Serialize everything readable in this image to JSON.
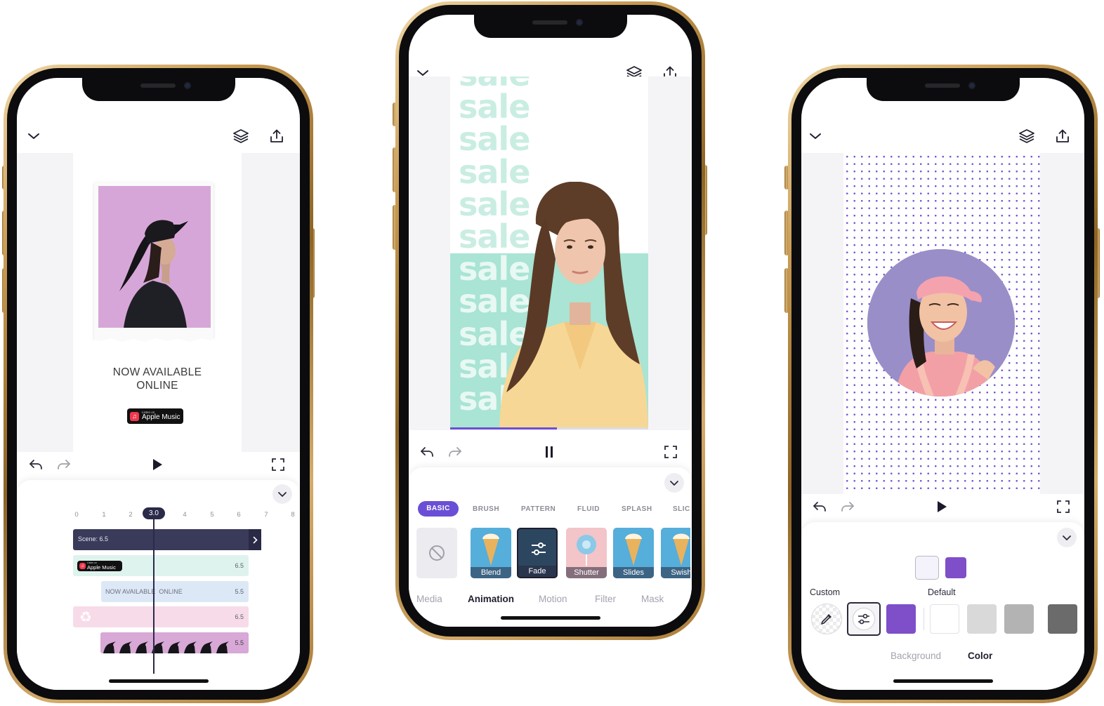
{
  "icons": {
    "collapse": "chevron-down-icon",
    "layers": "layers-icon",
    "share": "share-icon",
    "undo": "undo-icon",
    "redo": "redo-icon",
    "play": "play-icon",
    "pause": "pause-icon",
    "fullscreen": "fullscreen-icon"
  },
  "colors": {
    "accent": "#6a4fd6",
    "purple_swatch": "#7e4fc9",
    "mint": "#a9e4d4",
    "pink_photo": "#d7a6d8",
    "circle_bg": "#9a8ec9"
  },
  "phone1": {
    "poster": {
      "headline_line1": "NOW AVAILABLE",
      "headline_line2": "ONLINE",
      "badge_small": "Listen on",
      "badge_label": "Apple Music"
    },
    "timeline": {
      "ticks": [
        "0",
        "1",
        "2",
        "3.0",
        "4",
        "5",
        "6",
        "7",
        "8"
      ],
      "playhead_value": "3.0",
      "scene_label": "Scene: 6.5",
      "tracks": [
        {
          "type": "badge",
          "badge_small": "Listen on",
          "badge_label": "Apple Music",
          "duration": "6.5"
        },
        {
          "type": "text",
          "label": "NOW AVAILABLE  ONLINE",
          "duration": "5.5"
        },
        {
          "type": "sticker",
          "duration": "6.5"
        },
        {
          "type": "video",
          "duration": "5.5"
        }
      ]
    }
  },
  "phone2": {
    "sale_text": "sale",
    "sale_repeat_count": 11,
    "progress": 0.54,
    "animation_categories": [
      "BASIC",
      "BRUSH",
      "PATTERN",
      "FLUID",
      "SPLASH",
      "SLIC"
    ],
    "active_category": "BASIC",
    "animations": [
      {
        "label": "Blend",
        "selected": false
      },
      {
        "label": "Fade",
        "selected": true
      },
      {
        "label": "Shutter",
        "selected": false
      },
      {
        "label": "Slides",
        "selected": false
      },
      {
        "label": "Swish",
        "selected": false
      }
    ],
    "bottom_tabs": [
      "Media",
      "Animation",
      "Motion",
      "Filter",
      "Mask"
    ],
    "active_bottom_tab": "Animation"
  },
  "phone3": {
    "color_preview": [
      "#f4f2fb",
      "#7e4fc9"
    ],
    "section_custom": "Custom",
    "section_default": "Default",
    "custom_colors": [
      "#7e4fc9"
    ],
    "default_colors": [
      "#ffffff",
      "#d9d9d9",
      "#b3b3b3",
      "#6b6b6b"
    ],
    "bottom_tabs": [
      "Background",
      "Color"
    ],
    "active_bottom_tab": "Color"
  }
}
